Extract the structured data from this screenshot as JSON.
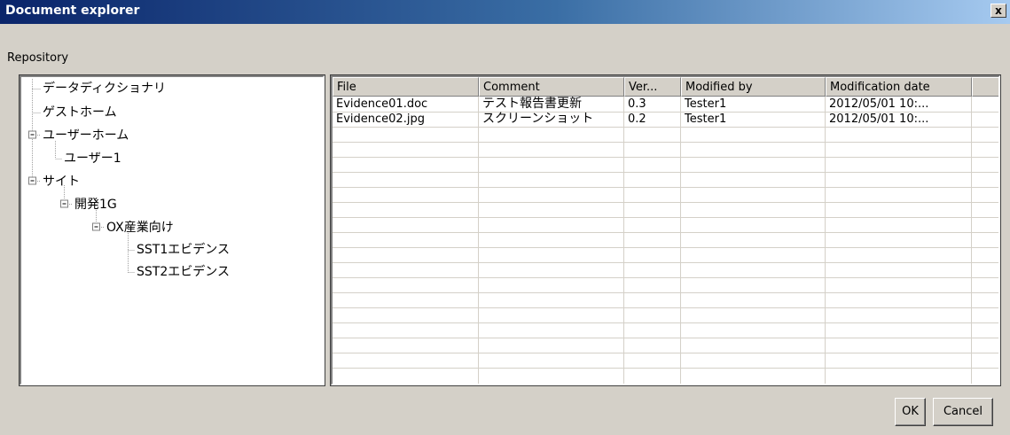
{
  "window": {
    "title": "Document explorer",
    "close_label": "x"
  },
  "repository": {
    "label": "Repository"
  },
  "tree": {
    "nodes": [
      {
        "label": "データディクショナリ",
        "expander": ""
      },
      {
        "label": "ゲストホーム",
        "expander": ""
      },
      {
        "label": "ユーザーホーム",
        "expander": "−"
      },
      {
        "label": "ユーザー1",
        "expander": ""
      },
      {
        "label": "サイト",
        "expander": "−"
      },
      {
        "label": "開発1G",
        "expander": "−"
      },
      {
        "label": "OX産業向け",
        "expander": "−"
      },
      {
        "label": "SST1エビデンス",
        "expander": ""
      },
      {
        "label": "SST2エビデンス",
        "expander": ""
      }
    ]
  },
  "table": {
    "columns": [
      "File",
      "Comment",
      "Ver...",
      "Modified by",
      "Modification date"
    ],
    "rows": [
      [
        "Evidence01.doc",
        "テスト報告書更新",
        "0.3",
        "Tester1",
        "2012/05/01 10:..."
      ],
      [
        "Evidence02.jpg",
        "スクリーンショット",
        "0.2",
        "Tester1",
        "2012/05/01 10:..."
      ]
    ]
  },
  "buttons": {
    "ok": "OK",
    "cancel": "Cancel"
  }
}
